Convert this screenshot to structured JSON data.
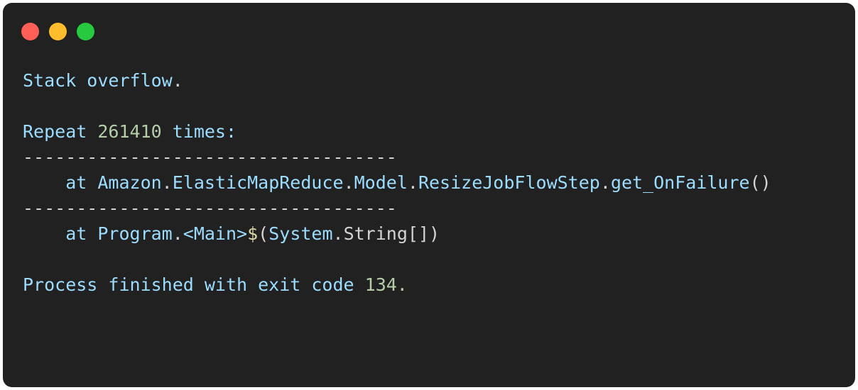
{
  "window": {
    "background_color": "#212121",
    "corner_radius_px": 13,
    "traffic_lights": [
      {
        "name": "close",
        "label": "Close",
        "color": "#FF5F56"
      },
      {
        "name": "minimize",
        "label": "Minimize",
        "color": "#FFBD2E"
      },
      {
        "name": "zoom",
        "label": "Zoom",
        "color": "#27C93F"
      }
    ]
  },
  "theme": {
    "identifier_color": "#9CDCFE",
    "number_color": "#B5CEA8",
    "punctuation_color": "#D4D4D4",
    "dollar_color": "#DCDCAA"
  },
  "console": {
    "lines": [
      {
        "id": "line-stack-overflow",
        "kind": "text",
        "spans": [
          {
            "text": "Stack overflow",
            "style": "kw"
          },
          {
            "text": ".",
            "style": "punct"
          }
        ]
      },
      {
        "id": "line-blank-1",
        "kind": "blank",
        "spans": []
      },
      {
        "id": "line-repeat-count",
        "kind": "text",
        "spans": [
          {
            "text": "Repeat ",
            "style": "kw"
          },
          {
            "text": "261410",
            "style": "num"
          },
          {
            "text": " times:",
            "style": "kw"
          }
        ]
      },
      {
        "id": "line-separator-1",
        "kind": "separator",
        "spans": [
          {
            "text": "-----------------------------------",
            "style": "sep"
          }
        ]
      },
      {
        "id": "line-frame-1",
        "kind": "text",
        "spans": [
          {
            "text": "    at Amazon",
            "style": "kw"
          },
          {
            "text": ".",
            "style": "punct"
          },
          {
            "text": "ElasticMapReduce",
            "style": "kw"
          },
          {
            "text": ".",
            "style": "punct"
          },
          {
            "text": "Model",
            "style": "kw"
          },
          {
            "text": ".",
            "style": "punct"
          },
          {
            "text": "ResizeJobFlowStep",
            "style": "kw"
          },
          {
            "text": ".",
            "style": "punct"
          },
          {
            "text": "get_OnFailure",
            "style": "kw"
          },
          {
            "text": "()",
            "style": "punct"
          }
        ]
      },
      {
        "id": "line-separator-2",
        "kind": "separator",
        "spans": [
          {
            "text": "-----------------------------------",
            "style": "sep"
          }
        ]
      },
      {
        "id": "line-frame-2",
        "kind": "text",
        "spans": [
          {
            "text": "    at Program",
            "style": "kw"
          },
          {
            "text": ".",
            "style": "punct"
          },
          {
            "text": "<Main>",
            "style": "kw"
          },
          {
            "text": "$",
            "style": "dollar"
          },
          {
            "text": "(",
            "style": "punct"
          },
          {
            "text": "System",
            "style": "kw"
          },
          {
            "text": ".String[])",
            "style": "plain"
          }
        ]
      },
      {
        "id": "line-blank-2",
        "kind": "blank",
        "spans": []
      },
      {
        "id": "line-exit-code",
        "kind": "text",
        "spans": [
          {
            "text": "Process finished with exit code ",
            "style": "kw"
          },
          {
            "text": "134.",
            "style": "num"
          }
        ]
      }
    ]
  }
}
